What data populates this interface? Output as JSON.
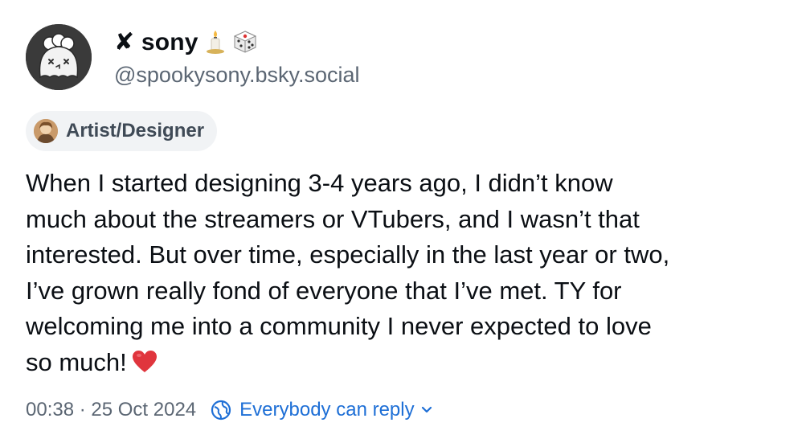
{
  "author": {
    "display_name": "✘ sony",
    "handle": "@spookysony.bsky.social",
    "name_emojis": [
      "candle-icon",
      "dice-icon"
    ]
  },
  "label": {
    "text": "Artist/Designer"
  },
  "post": {
    "lines": [
      "When I started designing 3-4 years ago, I didn’t know",
      "much about the streamers or VTubers, and I wasn’t that",
      "interested. But over time, especially in the last year or two,",
      "I’ve grown really fond of everyone that I’ve met. TY for",
      "welcoming me into a community I never expected to love",
      "so much!"
    ],
    "trailing_emoji": "heart-icon"
  },
  "meta": {
    "time": "00:38",
    "separator": " · ",
    "date": "25 Oct 2024",
    "reply_setting": "Everybody can reply"
  },
  "colors": {
    "text": "#0b0f14",
    "muted": "#5b6673",
    "link": "#1e6fd6",
    "badge_bg": "#f1f3f5",
    "heart": "#e0353d"
  }
}
